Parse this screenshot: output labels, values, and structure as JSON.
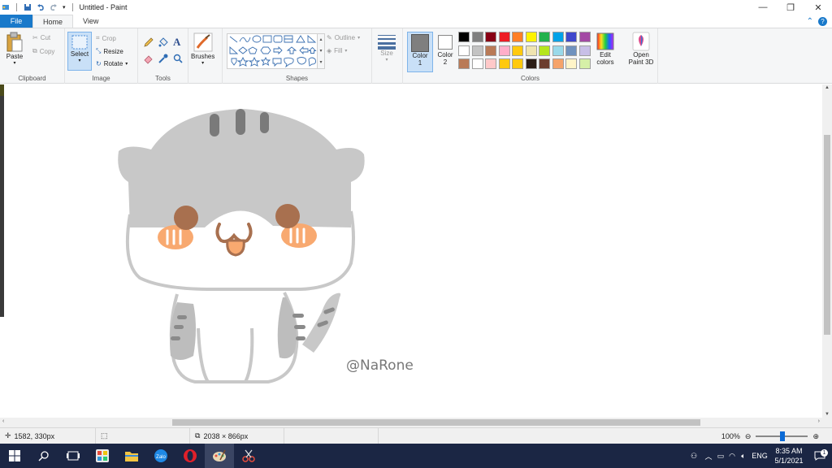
{
  "window": {
    "title": "Untitled - Paint"
  },
  "tabs": [
    {
      "label": "File"
    },
    {
      "label": "Home"
    },
    {
      "label": "View"
    }
  ],
  "ribbon": {
    "clipboard": {
      "paste": "Paste",
      "cut": "Cut",
      "copy": "Copy",
      "label": "Clipboard"
    },
    "image": {
      "select": "Select",
      "crop": "Crop",
      "resize": "Resize",
      "rotate": "Rotate",
      "label": "Image"
    },
    "tools": {
      "label": "Tools",
      "items": [
        "pencil-icon",
        "fill-icon",
        "text-icon",
        "eraser-icon",
        "color-picker-icon",
        "magnifier-icon"
      ]
    },
    "brushes": {
      "label": "Brushes"
    },
    "shapes": {
      "label": "Shapes",
      "outline": "Outline",
      "fill": "Fill"
    },
    "size": {
      "label": "Size"
    },
    "colors": {
      "color1": "Color 1",
      "color1_line1": "Color",
      "color1_line2": "1",
      "color2_line1": "Color",
      "color2_line2": "2",
      "edit_line1": "Edit",
      "edit_line2": "colors",
      "label": "Colors",
      "color1_value": "#7f7f7f",
      "color2_value": "#ffffff",
      "palette_row1": [
        "#000000",
        "#7f7f7f",
        "#880015",
        "#ed1c24",
        "#ff7f27",
        "#fff200",
        "#22b14c",
        "#00a2e8",
        "#3f48cc",
        "#a349a4"
      ],
      "palette_row2": [
        "#ffffff",
        "#c3c3c3",
        "#b97a57",
        "#ffaec9",
        "#ffc90e",
        "#efe4b0",
        "#b5e61d",
        "#99d9ea",
        "#7092be",
        "#c8bfe7"
      ],
      "palette_row3": [
        "#b97a57",
        "#ffffff",
        "#ffc9c9",
        "#ffc90e",
        "#ffc90e",
        "#2b1d16",
        "#6b3d2e",
        "#f5a36a",
        "#fff4c8",
        "#d6f0a8"
      ]
    },
    "paint3d": {
      "line1": "Open",
      "line2": "Paint 3D"
    }
  },
  "canvas": {
    "watermark": "@NaRone"
  },
  "statusbar": {
    "cursor": "1582, 330px",
    "image_size": "2038 × 866px",
    "zoom": "100%"
  },
  "taskbar": {
    "lang": "ENG",
    "time": "8:35 AM",
    "date": "5/1/2021",
    "notification_count": "1"
  }
}
